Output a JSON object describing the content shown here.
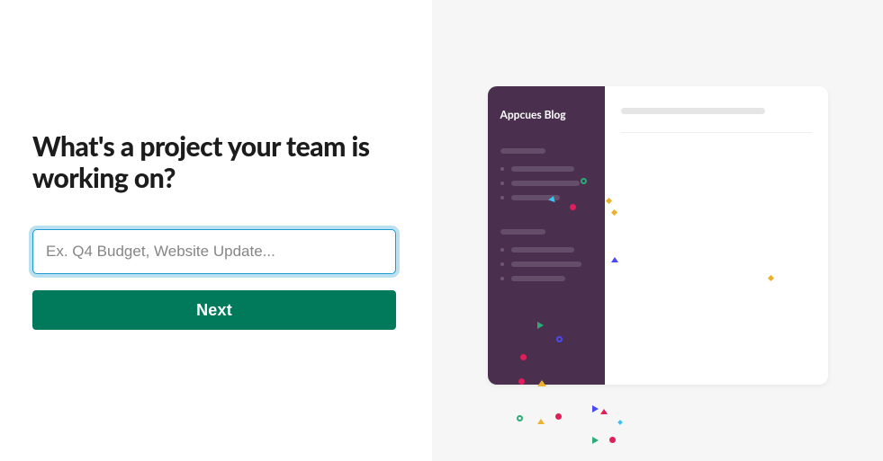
{
  "form": {
    "heading": "What's a project your team is working on?",
    "placeholder": "Ex. Q4 Budget, Website Update...",
    "value": "",
    "next_label": "Next"
  },
  "preview": {
    "sidebar_title": "Appcues Blog"
  },
  "colors": {
    "primary_button": "#007a5a",
    "sidebar_bg": "#4a2f4f",
    "right_bg": "#f6f6f6",
    "focus_ring": "#1d9bd1"
  }
}
